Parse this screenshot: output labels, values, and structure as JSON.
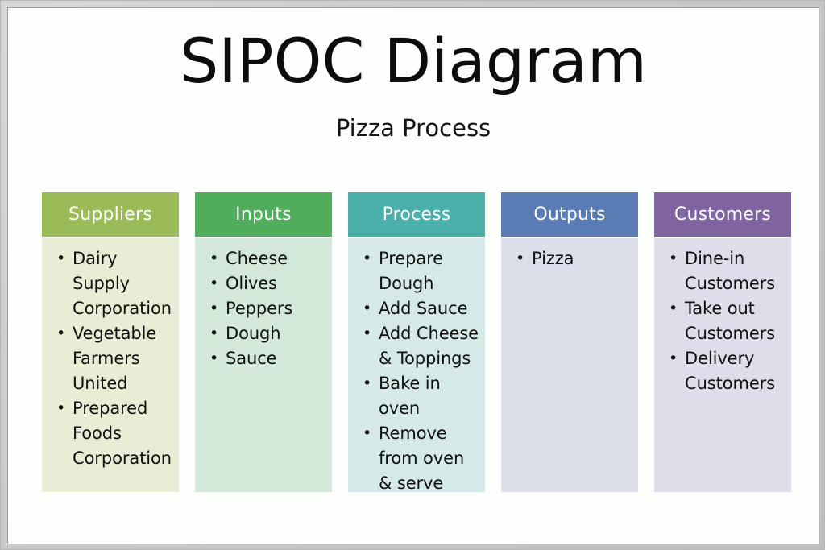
{
  "diagram": {
    "title": "SIPOC Diagram",
    "subtitle": "Pizza Process",
    "columns": [
      {
        "id": "suppliers",
        "header": "Suppliers",
        "header_color": "#9BBB59",
        "body_color": "#E8EDD6",
        "items": [
          "Dairy Supply Corporation",
          "Vegetable Farmers United",
          "Prepared Foods Corporation"
        ]
      },
      {
        "id": "inputs",
        "header": "Inputs",
        "header_color": "#4FAD5B",
        "body_color": "#D3E8D8",
        "items": [
          "Cheese",
          "Olives",
          "Peppers",
          "Dough",
          "Sauce"
        ]
      },
      {
        "id": "process",
        "header": "Process",
        "header_color": "#4BAFAA",
        "body_color": "#D5E9E8",
        "items": [
          "Prepare Dough",
          "Add Sauce",
          "Add Cheese & Toppings",
          "Bake in oven",
          "Remove from oven & serve"
        ]
      },
      {
        "id": "outputs",
        "header": "Outputs",
        "header_color": "#5A7CB4",
        "body_color": "#DCDFEA",
        "items": [
          "Pizza"
        ]
      },
      {
        "id": "customers",
        "header": "Customers",
        "header_color": "#8064A2",
        "body_color": "#E0DCE9",
        "items": [
          "Dine-in Customers",
          "Take out Customers",
          "Delivery Customers"
        ]
      }
    ]
  }
}
